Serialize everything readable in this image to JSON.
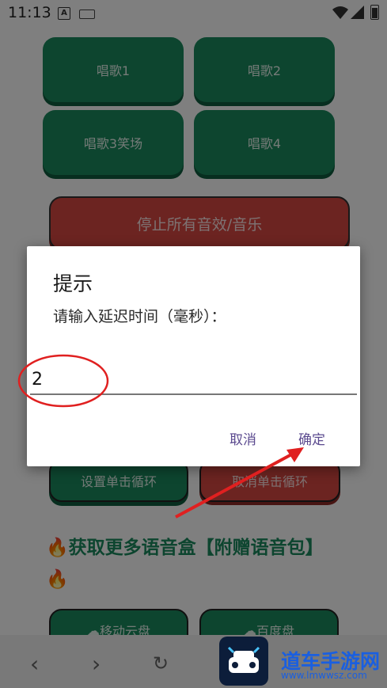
{
  "status_bar": {
    "time": "11:13",
    "a_icon_letter": "A"
  },
  "app": {
    "buttons": [
      {
        "label": "唱歌1"
      },
      {
        "label": "唱歌2"
      },
      {
        "label": "唱歌3笑场"
      },
      {
        "label": "唱歌4"
      }
    ],
    "stop_button": "停止所有音效/音乐",
    "set_loop_button": "设置单击循环",
    "cancel_loop_button": "取消单击循环",
    "promo": {
      "prefix_icon": "fire-icon",
      "text": "获取更多语音盒【附赠语音包】"
    },
    "bottom_buttons": [
      {
        "label": "移动云盘"
      },
      {
        "label": "百度盘"
      }
    ]
  },
  "dialog": {
    "title": "提示",
    "message": "请输入延迟时间（毫秒）：",
    "input_value": "2",
    "cancel_label": "取消",
    "confirm_label": "确定"
  },
  "annotation": {
    "circle_color": "#e02020",
    "arrow_color": "#e02020"
  },
  "watermark": {
    "text": "道车手游网",
    "url": "www.lmwwsz.com"
  },
  "colors": {
    "green": "#1b8a5f",
    "red": "#d94843",
    "accent": "#5b4a8f"
  }
}
